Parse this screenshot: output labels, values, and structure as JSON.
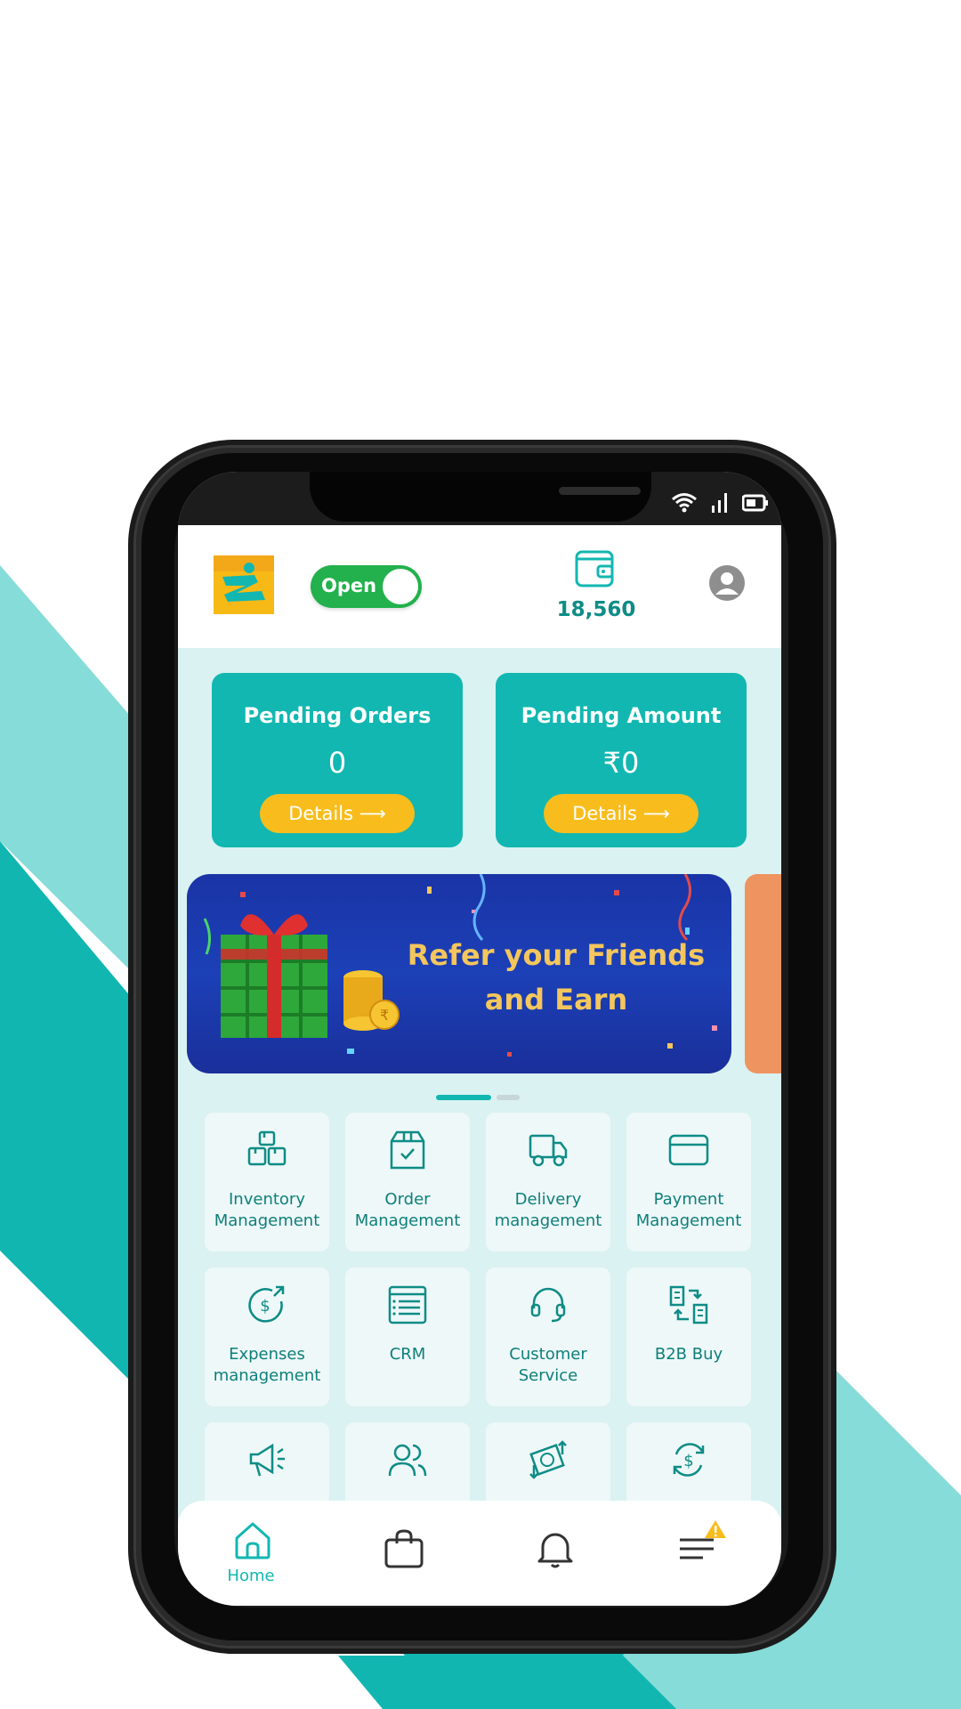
{
  "colors": {
    "accent": "#12b7b1",
    "accent_dark": "#0e8c86",
    "yellow": "#f8bd1c",
    "toggle_green": "#22b14c",
    "screen_bg": "#daf2f1",
    "bg_stripe_light": "#86dcd8",
    "bg_stripe_dark": "#11b6b1"
  },
  "status_bar": {
    "icons": [
      "wifi-icon",
      "signal-icon",
      "battery-icon"
    ]
  },
  "header": {
    "store_toggle_label": "Open",
    "store_toggle_on": true,
    "wallet_balance": "18,560"
  },
  "summary_cards": [
    {
      "title": "Pending Orders",
      "value": "0",
      "button_label": "Details"
    },
    {
      "title": "Pending Amount",
      "value": "₹0",
      "button_label": "Details"
    }
  ],
  "banner": {
    "line1": "Refer your Friends",
    "line2": "and Earn",
    "active_index": 0,
    "count": 2
  },
  "features": [
    {
      "label_line1": "Inventory",
      "label_line2": "Management",
      "icon": "boxes-icon"
    },
    {
      "label_line1": "Order",
      "label_line2": "Management",
      "icon": "package-check-icon"
    },
    {
      "label_line1": "Delivery",
      "label_line2": "management",
      "icon": "truck-icon"
    },
    {
      "label_line1": "Payment",
      "label_line2": "Management",
      "icon": "credit-card-icon"
    },
    {
      "label_line1": "Expenses",
      "label_line2": "management",
      "icon": "expense-icon"
    },
    {
      "label_line1": "CRM",
      "label_line2": "",
      "icon": "crm-icon"
    },
    {
      "label_line1": "Customer",
      "label_line2": "Service",
      "icon": "headset-icon"
    },
    {
      "label_line1": "B2B Buy",
      "label_line2": "",
      "icon": "b2b-icon"
    },
    {
      "label_line1": "",
      "label_line2": "",
      "icon": "megaphone-icon"
    },
    {
      "label_line1": "",
      "label_line2": "",
      "icon": "users-icon"
    },
    {
      "label_line1": "",
      "label_line2": "",
      "icon": "cash-transfer-icon"
    },
    {
      "label_line1": "",
      "label_line2": "",
      "icon": "cycle-dollar-icon"
    }
  ],
  "tabbar": {
    "home_label": "Home",
    "active": "home",
    "tabs": [
      "home-icon",
      "shopping-bag-icon",
      "bell-icon",
      "menu-icon"
    ]
  }
}
